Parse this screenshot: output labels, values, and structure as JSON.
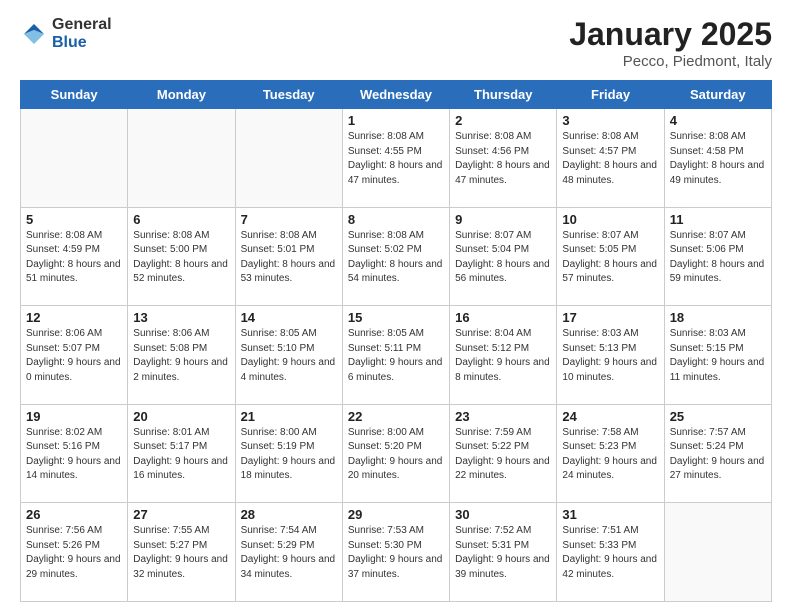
{
  "logo": {
    "general": "General",
    "blue": "Blue"
  },
  "title": "January 2025",
  "subtitle": "Pecco, Piedmont, Italy",
  "days_of_week": [
    "Sunday",
    "Monday",
    "Tuesday",
    "Wednesday",
    "Thursday",
    "Friday",
    "Saturday"
  ],
  "weeks": [
    [
      {
        "day": "",
        "info": ""
      },
      {
        "day": "",
        "info": ""
      },
      {
        "day": "",
        "info": ""
      },
      {
        "day": "1",
        "info": "Sunrise: 8:08 AM\nSunset: 4:55 PM\nDaylight: 8 hours\nand 47 minutes."
      },
      {
        "day": "2",
        "info": "Sunrise: 8:08 AM\nSunset: 4:56 PM\nDaylight: 8 hours\nand 47 minutes."
      },
      {
        "day": "3",
        "info": "Sunrise: 8:08 AM\nSunset: 4:57 PM\nDaylight: 8 hours\nand 48 minutes."
      },
      {
        "day": "4",
        "info": "Sunrise: 8:08 AM\nSunset: 4:58 PM\nDaylight: 8 hours\nand 49 minutes."
      }
    ],
    [
      {
        "day": "5",
        "info": "Sunrise: 8:08 AM\nSunset: 4:59 PM\nDaylight: 8 hours\nand 51 minutes."
      },
      {
        "day": "6",
        "info": "Sunrise: 8:08 AM\nSunset: 5:00 PM\nDaylight: 8 hours\nand 52 minutes."
      },
      {
        "day": "7",
        "info": "Sunrise: 8:08 AM\nSunset: 5:01 PM\nDaylight: 8 hours\nand 53 minutes."
      },
      {
        "day": "8",
        "info": "Sunrise: 8:08 AM\nSunset: 5:02 PM\nDaylight: 8 hours\nand 54 minutes."
      },
      {
        "day": "9",
        "info": "Sunrise: 8:07 AM\nSunset: 5:04 PM\nDaylight: 8 hours\nand 56 minutes."
      },
      {
        "day": "10",
        "info": "Sunrise: 8:07 AM\nSunset: 5:05 PM\nDaylight: 8 hours\nand 57 minutes."
      },
      {
        "day": "11",
        "info": "Sunrise: 8:07 AM\nSunset: 5:06 PM\nDaylight: 8 hours\nand 59 minutes."
      }
    ],
    [
      {
        "day": "12",
        "info": "Sunrise: 8:06 AM\nSunset: 5:07 PM\nDaylight: 9 hours\nand 0 minutes."
      },
      {
        "day": "13",
        "info": "Sunrise: 8:06 AM\nSunset: 5:08 PM\nDaylight: 9 hours\nand 2 minutes."
      },
      {
        "day": "14",
        "info": "Sunrise: 8:05 AM\nSunset: 5:10 PM\nDaylight: 9 hours\nand 4 minutes."
      },
      {
        "day": "15",
        "info": "Sunrise: 8:05 AM\nSunset: 5:11 PM\nDaylight: 9 hours\nand 6 minutes."
      },
      {
        "day": "16",
        "info": "Sunrise: 8:04 AM\nSunset: 5:12 PM\nDaylight: 9 hours\nand 8 minutes."
      },
      {
        "day": "17",
        "info": "Sunrise: 8:03 AM\nSunset: 5:13 PM\nDaylight: 9 hours\nand 10 minutes."
      },
      {
        "day": "18",
        "info": "Sunrise: 8:03 AM\nSunset: 5:15 PM\nDaylight: 9 hours\nand 11 minutes."
      }
    ],
    [
      {
        "day": "19",
        "info": "Sunrise: 8:02 AM\nSunset: 5:16 PM\nDaylight: 9 hours\nand 14 minutes."
      },
      {
        "day": "20",
        "info": "Sunrise: 8:01 AM\nSunset: 5:17 PM\nDaylight: 9 hours\nand 16 minutes."
      },
      {
        "day": "21",
        "info": "Sunrise: 8:00 AM\nSunset: 5:19 PM\nDaylight: 9 hours\nand 18 minutes."
      },
      {
        "day": "22",
        "info": "Sunrise: 8:00 AM\nSunset: 5:20 PM\nDaylight: 9 hours\nand 20 minutes."
      },
      {
        "day": "23",
        "info": "Sunrise: 7:59 AM\nSunset: 5:22 PM\nDaylight: 9 hours\nand 22 minutes."
      },
      {
        "day": "24",
        "info": "Sunrise: 7:58 AM\nSunset: 5:23 PM\nDaylight: 9 hours\nand 24 minutes."
      },
      {
        "day": "25",
        "info": "Sunrise: 7:57 AM\nSunset: 5:24 PM\nDaylight: 9 hours\nand 27 minutes."
      }
    ],
    [
      {
        "day": "26",
        "info": "Sunrise: 7:56 AM\nSunset: 5:26 PM\nDaylight: 9 hours\nand 29 minutes."
      },
      {
        "day": "27",
        "info": "Sunrise: 7:55 AM\nSunset: 5:27 PM\nDaylight: 9 hours\nand 32 minutes."
      },
      {
        "day": "28",
        "info": "Sunrise: 7:54 AM\nSunset: 5:29 PM\nDaylight: 9 hours\nand 34 minutes."
      },
      {
        "day": "29",
        "info": "Sunrise: 7:53 AM\nSunset: 5:30 PM\nDaylight: 9 hours\nand 37 minutes."
      },
      {
        "day": "30",
        "info": "Sunrise: 7:52 AM\nSunset: 5:31 PM\nDaylight: 9 hours\nand 39 minutes."
      },
      {
        "day": "31",
        "info": "Sunrise: 7:51 AM\nSunset: 5:33 PM\nDaylight: 9 hours\nand 42 minutes."
      },
      {
        "day": "",
        "info": ""
      }
    ]
  ]
}
